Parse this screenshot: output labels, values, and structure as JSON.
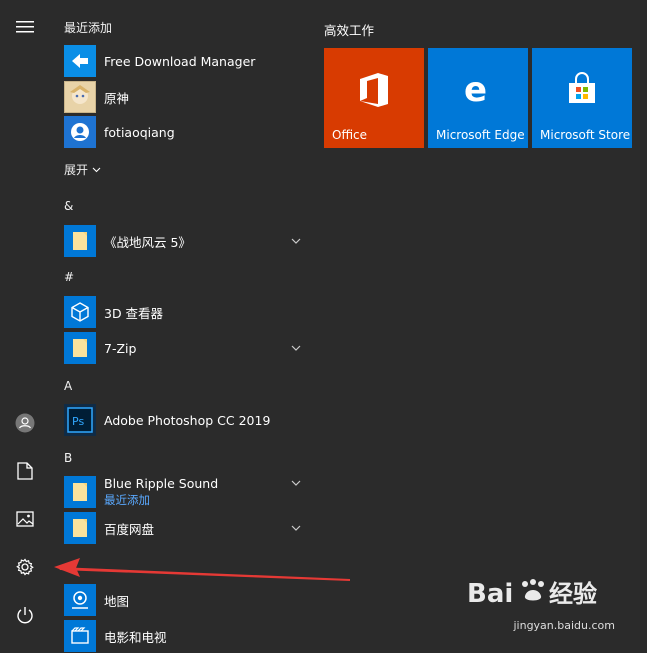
{
  "recent": {
    "heading": "最近添加",
    "items": [
      {
        "label": "Free Download Manager",
        "icon": "free-download-manager-icon"
      },
      {
        "label": "原神",
        "icon": "genshin-icon"
      },
      {
        "label": "fotiaoqiang",
        "icon": "fotiaoqiang-icon"
      }
    ]
  },
  "expand_label": "展开",
  "groups": [
    {
      "letter": "&",
      "items": [
        {
          "label": "《战地风云 5》",
          "icon": "folder-icon",
          "chevron": true
        }
      ]
    },
    {
      "letter": "#",
      "items": [
        {
          "label": "3D 查看器",
          "icon": "3d-viewer-icon"
        },
        {
          "label": "7-Zip",
          "icon": "folder-icon",
          "chevron": true
        }
      ]
    },
    {
      "letter": "A",
      "items": [
        {
          "label": "Adobe Photoshop CC 2019",
          "icon": "photoshop-icon"
        }
      ]
    },
    {
      "letter": "B",
      "items": [
        {
          "label": "Blue Ripple Sound",
          "sub": "最近添加",
          "icon": "folder-icon",
          "chevron": true
        },
        {
          "label": "百度网盘",
          "icon": "folder-icon",
          "chevron": true
        },
        {
          "label": "地图",
          "icon": "maps-icon"
        },
        {
          "label": "电影和电视",
          "icon": "movies-tv-icon"
        }
      ]
    }
  ],
  "tiles": {
    "heading": "高效工作",
    "items": [
      {
        "label": "Office",
        "color": "#d83b01",
        "icon": "office-icon"
      },
      {
        "label": "Microsoft Edge",
        "color": "#0078d7",
        "icon": "edge-icon"
      },
      {
        "label": "Microsoft Store",
        "color": "#0078d7",
        "icon": "store-icon"
      }
    ]
  },
  "rail": [
    "hamburger-menu-icon",
    "user-icon",
    "documents-icon",
    "pictures-icon",
    "settings-icon",
    "power-icon"
  ],
  "watermark": {
    "brand": "Baidu经验",
    "url": "jingyan.baidu.com"
  }
}
